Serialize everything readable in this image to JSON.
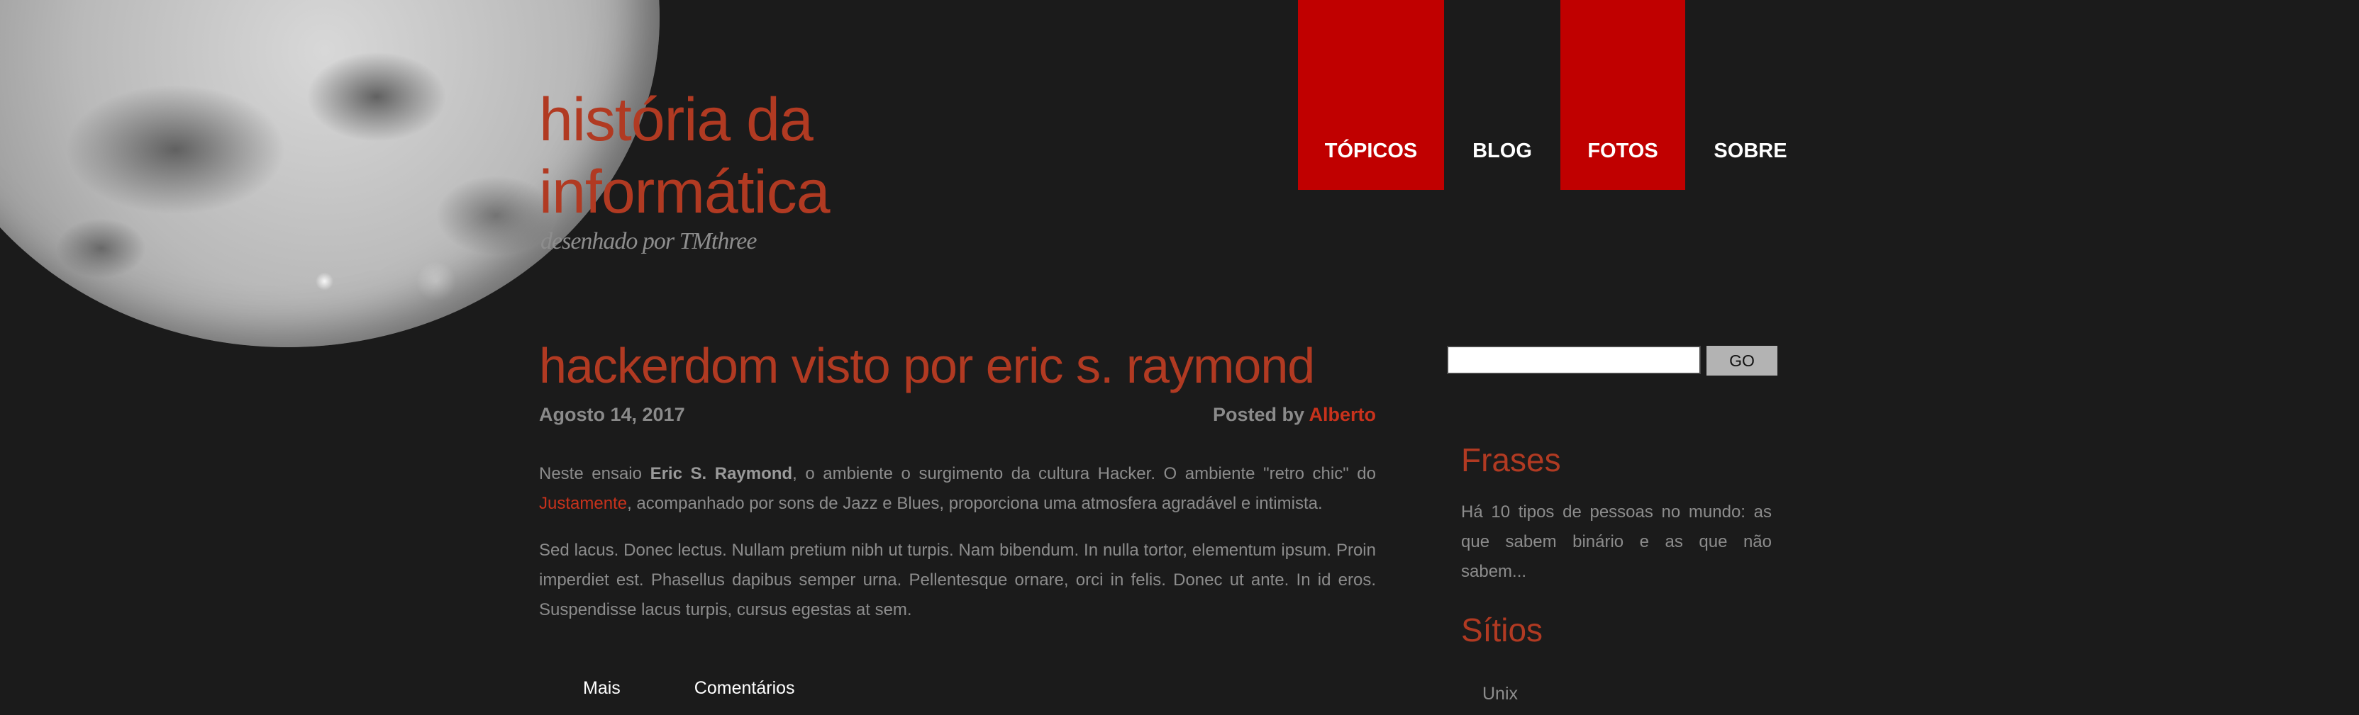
{
  "header": {
    "title": "história da informática",
    "tagline": "desenhado por TMthree"
  },
  "nav": {
    "items": [
      {
        "label": "TÓPICOS",
        "active": true
      },
      {
        "label": "BLOG",
        "active": false
      },
      {
        "label": "FOTOS",
        "active": true
      },
      {
        "label": "SOBRE",
        "active": false
      }
    ]
  },
  "post": {
    "title": "hackerdom visto por eric s. raymond",
    "date": "Agosto 14, 2017",
    "posted_by_label": "Posted by",
    "author": "Alberto",
    "p1_a": "Neste ensaio ",
    "p1_bold": "Eric S. Raymond",
    "p1_b": ", o ambiente o surgimento da cultura Hacker. O ambiente \"retro chic\" do ",
    "p1_link": "Justamente",
    "p1_c": ", acompanhado por sons de Jazz e Blues, proporciona uma atmosfera agradável e intimista.",
    "p2": "Sed lacus. Donec lectus. Nullam pretium nibh ut turpis. Nam bibendum. In nulla tortor, elementum ipsum. Proin imperdiet est. Phasellus dapibus semper urna. Pellentesque ornare, orci in felis. Donec ut ante. In id eros. Suspendisse lacus turpis, cursus egestas at sem.",
    "more_label": "Mais",
    "comments_label": "Comentários"
  },
  "sidebar": {
    "search": {
      "value": "",
      "button_label": "GO"
    },
    "quotes_heading": "Frases",
    "quote_text": "Há 10 tipos de pessoas no mundo: as que sabem binário e as que não sabem...",
    "sites_heading": "Sítios",
    "sites": [
      "Unix"
    ]
  },
  "colors": {
    "background": "#1b1b1b",
    "accent": "#b13a22",
    "nav_active": "#c00000",
    "text": "#8c8c8c"
  }
}
